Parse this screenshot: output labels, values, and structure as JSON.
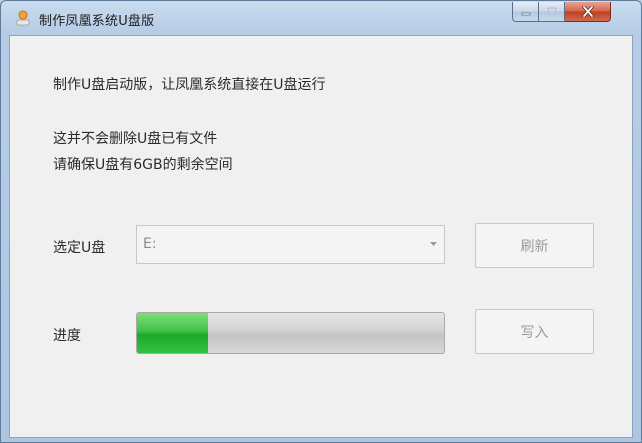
{
  "window": {
    "title": "制作凤凰系统U盘版",
    "icon": "phoenix-app-icon",
    "controls": [
      "minimize-icon",
      "maximize-icon",
      "close-icon"
    ],
    "accent_close": "#c8452a"
  },
  "content": {
    "intro": "制作U盘启动版，让凤凰系统直接在U盘运行",
    "note_line1": "这并不会删除U盘已有文件",
    "note_line2": "请确保U盘有6GB的剩余空间"
  },
  "drive_row": {
    "label": "选定U盘",
    "selected_value": "E:",
    "refresh_label": "刷新"
  },
  "progress_row": {
    "label": "进度",
    "progress_fraction": 0.23,
    "progress_color": "#2fb83a",
    "write_label": "写入"
  }
}
